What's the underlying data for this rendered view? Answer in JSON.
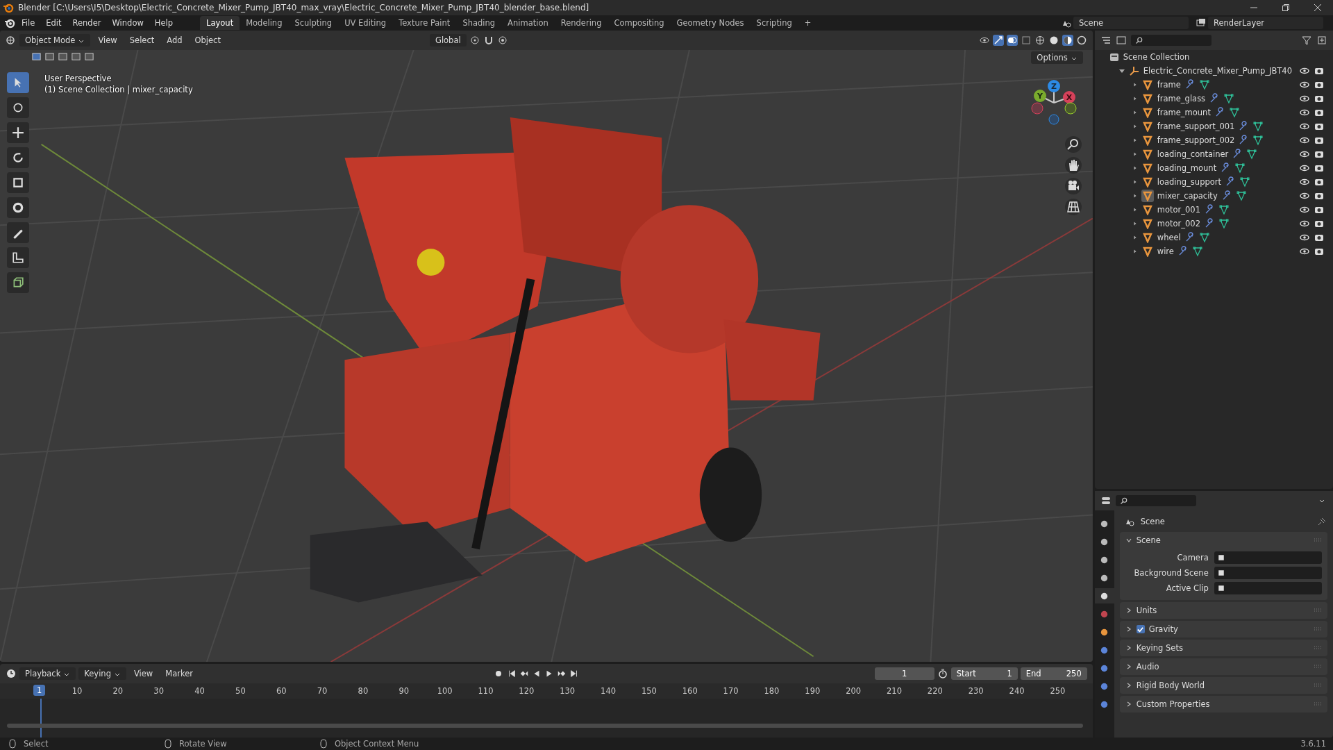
{
  "title_bar": {
    "title": "Blender [C:\\Users\\I5\\Desktop\\Electric_Concrete_Mixer_Pump_JBT40_max_vray\\Electric_Concrete_Mixer_Pump_JBT40_blender_base.blend]"
  },
  "menu": [
    "File",
    "Edit",
    "Render",
    "Window",
    "Help"
  ],
  "workspaces": [
    {
      "label": "Layout",
      "selected": true
    },
    {
      "label": "Modeling",
      "selected": false
    },
    {
      "label": "Sculpting",
      "selected": false
    },
    {
      "label": "UV Editing",
      "selected": false
    },
    {
      "label": "Texture Paint",
      "selected": false
    },
    {
      "label": "Shading",
      "selected": false
    },
    {
      "label": "Animation",
      "selected": false
    },
    {
      "label": "Rendering",
      "selected": false
    },
    {
      "label": "Compositing",
      "selected": false
    },
    {
      "label": "Geometry Nodes",
      "selected": false
    },
    {
      "label": "Scripting",
      "selected": false
    }
  ],
  "add_workspace": "+",
  "scene": "Scene",
  "view_layer": "RenderLayer",
  "viewport": {
    "mode": "Object Mode",
    "menus": [
      "View",
      "Select",
      "Add",
      "Object"
    ],
    "orientation": "Global",
    "options": "Options",
    "info": [
      "User Perspective",
      "(1) Scene Collection | mixer_capacity"
    ],
    "axes": [
      "Z",
      "Y",
      "X"
    ],
    "tools": [
      {
        "selected": true
      },
      {
        "selected": false
      },
      {
        "selected": false
      },
      {
        "selected": false
      },
      {
        "selected": false
      },
      {
        "selected": false
      },
      {
        "selected": false
      },
      {
        "selected": false
      },
      {
        "selected": false
      }
    ]
  },
  "outliner": {
    "root": "Scene Collection",
    "collection": {
      "name": "Electric_Concrete_Mixer_Pump_JBT40",
      "expanded": true,
      "children": [
        {
          "name": "frame",
          "selected": false
        },
        {
          "name": "frame_glass",
          "selected": false
        },
        {
          "name": "frame_mount",
          "selected": false
        },
        {
          "name": "frame_support_001",
          "selected": false
        },
        {
          "name": "frame_support_002",
          "selected": false
        },
        {
          "name": "loading_container",
          "selected": false
        },
        {
          "name": "loading_mount",
          "selected": false
        },
        {
          "name": "loading_support",
          "selected": false
        },
        {
          "name": "mixer_capacity",
          "selected": true
        },
        {
          "name": "motor_001",
          "selected": false
        },
        {
          "name": "motor_002",
          "selected": false
        },
        {
          "name": "wheel",
          "selected": false
        },
        {
          "name": "wire",
          "selected": false
        }
      ]
    }
  },
  "properties": {
    "tabs": [
      {
        "selected": false
      },
      {
        "selected": false
      },
      {
        "selected": false
      },
      {
        "selected": false
      },
      {
        "selected": true
      },
      {
        "selected": false
      },
      {
        "selected": false
      },
      {
        "selected": false
      },
      {
        "selected": false
      },
      {
        "selected": false
      },
      {
        "selected": false
      }
    ],
    "header": "Scene",
    "panels": [
      {
        "title": "Scene",
        "kind": "plain",
        "expanded": true,
        "fields": [
          "Camera",
          "Background Scene",
          "Active Clip"
        ]
      },
      {
        "title": "Units",
        "kind": "plain",
        "expanded": false
      },
      {
        "title": "Gravity",
        "kind": "checkbox",
        "checked": true,
        "expanded": false
      },
      {
        "title": "Keying Sets",
        "kind": "plain",
        "expanded": false
      },
      {
        "title": "Audio",
        "kind": "plain",
        "expanded": false
      },
      {
        "title": "Rigid Body World",
        "kind": "plain",
        "expanded": false
      },
      {
        "title": "Custom Properties",
        "kind": "plain",
        "expanded": false
      }
    ]
  },
  "timeline": {
    "menus": [
      "Playback",
      "Keying",
      "View",
      "Marker"
    ],
    "current_frame": "1",
    "start_label": "Start",
    "start": "1",
    "end_label": "End",
    "end": "250",
    "frame_marker": "1",
    "ticks": [
      "10",
      "20",
      "30",
      "40",
      "50",
      "60",
      "70",
      "80",
      "90",
      "100",
      "110",
      "120",
      "130",
      "140",
      "150",
      "160",
      "170",
      "180",
      "190",
      "200",
      "210",
      "220",
      "230",
      "240",
      "250"
    ]
  },
  "status_bar": {
    "hints": [
      "Select",
      "Rotate View",
      "Object Context Menu"
    ],
    "version": "3.6.11"
  }
}
